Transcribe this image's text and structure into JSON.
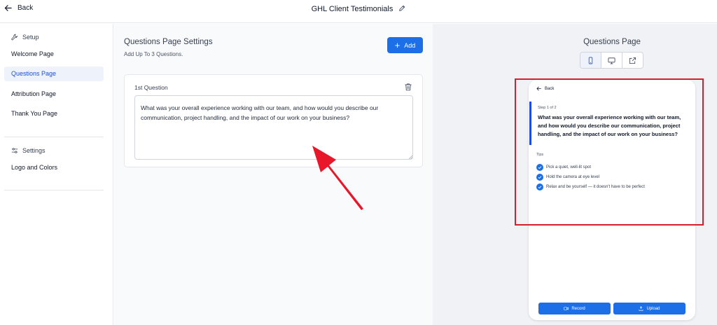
{
  "topbar": {
    "back_label": "Back",
    "title": "GHL Client Testimonials"
  },
  "sidebar": {
    "setup_heading": "Setup",
    "setup_items": [
      {
        "label": "Welcome Page"
      },
      {
        "label": "Questions Page"
      },
      {
        "label": "Attribution Page"
      },
      {
        "label": "Thank You Page"
      }
    ],
    "settings_heading": "Settings",
    "settings_items": [
      {
        "label": "Logo and Colors"
      }
    ]
  },
  "questions_panel": {
    "heading": "Questions Page Settings",
    "subheading": "Add Up To 3 Questions.",
    "add_label": "Add",
    "question_label": "1st Question",
    "question_value": "What was your overall experience working with our team, and how would you describe our communication, project handling, and the impact of our work on your business?"
  },
  "preview": {
    "title": "Questions Page",
    "back_label": "Back",
    "step_text": "Step 1 of 2",
    "question": "What was your overall experience working with our team, and how would you describe our communication, project handling, and the impact of our work on your business?",
    "tips_label": "Tips",
    "tips": [
      "Pick a quiet, well-lit spot",
      "Hold the camera at eye level",
      "Relax and be yourself — it doesn't have to be perfect"
    ],
    "record_label": "Record",
    "upload_label": "Upload"
  },
  "colors": {
    "accent": "#1d6fe8",
    "annotation": "#d61f2c",
    "active_bg": "#eef3fb"
  }
}
